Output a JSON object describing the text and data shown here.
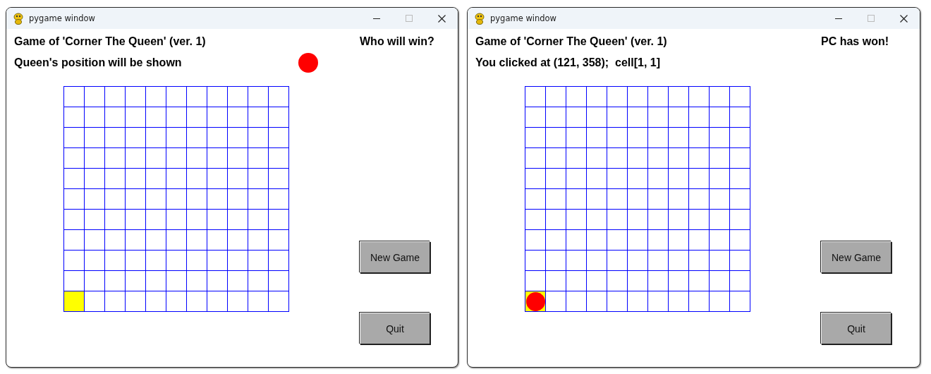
{
  "windows": [
    {
      "title": "pygame window",
      "heading": "Game of 'Corner The Queen' (ver. 1)",
      "message": "Queen's position will be shown",
      "status": "Who will win?",
      "queen_marker": true,
      "buttons": [
        "New Game",
        "Quit"
      ],
      "board": {
        "corner_highlighted": true,
        "queen_in_corner": false
      }
    },
    {
      "title": "pygame window",
      "heading": "Game of 'Corner The Queen' (ver. 1)",
      "message": "You clicked at (121, 358);  cell[1, 1]",
      "status": "PC has won!",
      "queen_marker": false,
      "buttons": [
        "New Game",
        "Quit"
      ],
      "board": {
        "corner_highlighted": true,
        "queen_in_corner": true
      }
    }
  ]
}
